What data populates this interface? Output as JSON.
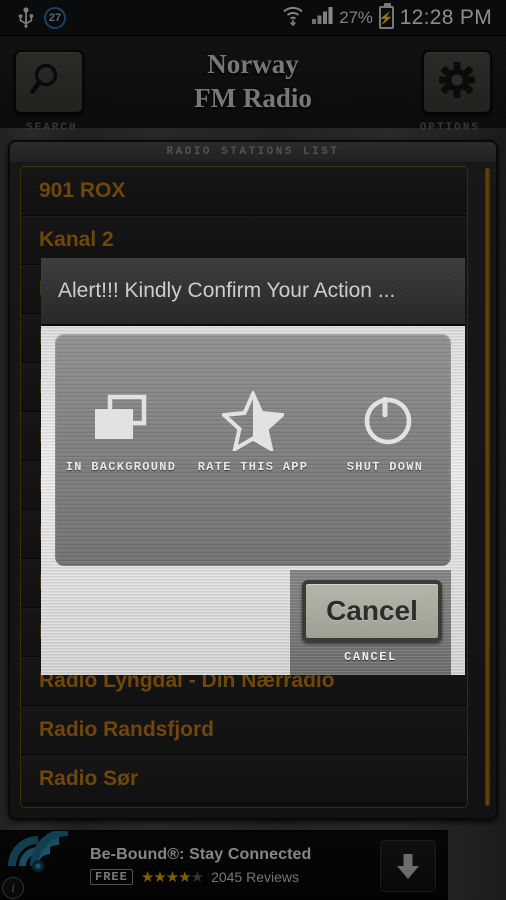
{
  "statusbar": {
    "usb_icon": "usb-icon",
    "notification_count": "27",
    "wifi_icon": "wifi-icon",
    "signal_icon": "signal-bars-icon",
    "battery_percent": "27%",
    "battery_icon": "battery-charging-icon",
    "clock": "12:28 PM"
  },
  "header": {
    "title_line1": "Norway",
    "title_line2": "FM Radio",
    "search_icon": "search-icon",
    "search_label": "SEARCH",
    "options_icon": "gear-icon",
    "options_label": "OPTIONS"
  },
  "list": {
    "header": "RADIO STATIONS LIST",
    "items": [
      {
        "label": "901 ROX"
      },
      {
        "label": "Kanal 2"
      },
      {
        "label": "M"
      },
      {
        "label": "M"
      },
      {
        "label": "M"
      },
      {
        "label": "M"
      },
      {
        "label": "M"
      },
      {
        "label": "M"
      },
      {
        "label": "N"
      },
      {
        "label": "R"
      },
      {
        "label": "Radio Lyngdal - Din Nærradio"
      },
      {
        "label": "Radio Randsfjord"
      },
      {
        "label": "Radio Sør"
      }
    ]
  },
  "dialog": {
    "title": "Alert!!! Kindly Confirm Your Action ...",
    "options": [
      {
        "label": "IN BACKGROUND",
        "icon": "windows-stack-icon"
      },
      {
        "label": "RATE THIS APP",
        "icon": "half-star-icon"
      },
      {
        "label": "SHUT DOWN",
        "icon": "power-icon"
      }
    ],
    "cancel_button": "Cancel",
    "cancel_caption": "CANCEL"
  },
  "ad": {
    "logo_icon": "signal-waves-logo-icon",
    "info_icon": "info-icon",
    "title": "Be-Bound®: Stay Connected",
    "price_badge": "FREE",
    "rating_filled": "★★★★",
    "rating_empty": "★",
    "reviews": "2045 Reviews",
    "download_icon": "download-arrow-icon"
  },
  "colors": {
    "accent_orange": "#c07a12",
    "ad_logo_teal": "#2a7f9e",
    "star_gold": "#d9a400"
  }
}
